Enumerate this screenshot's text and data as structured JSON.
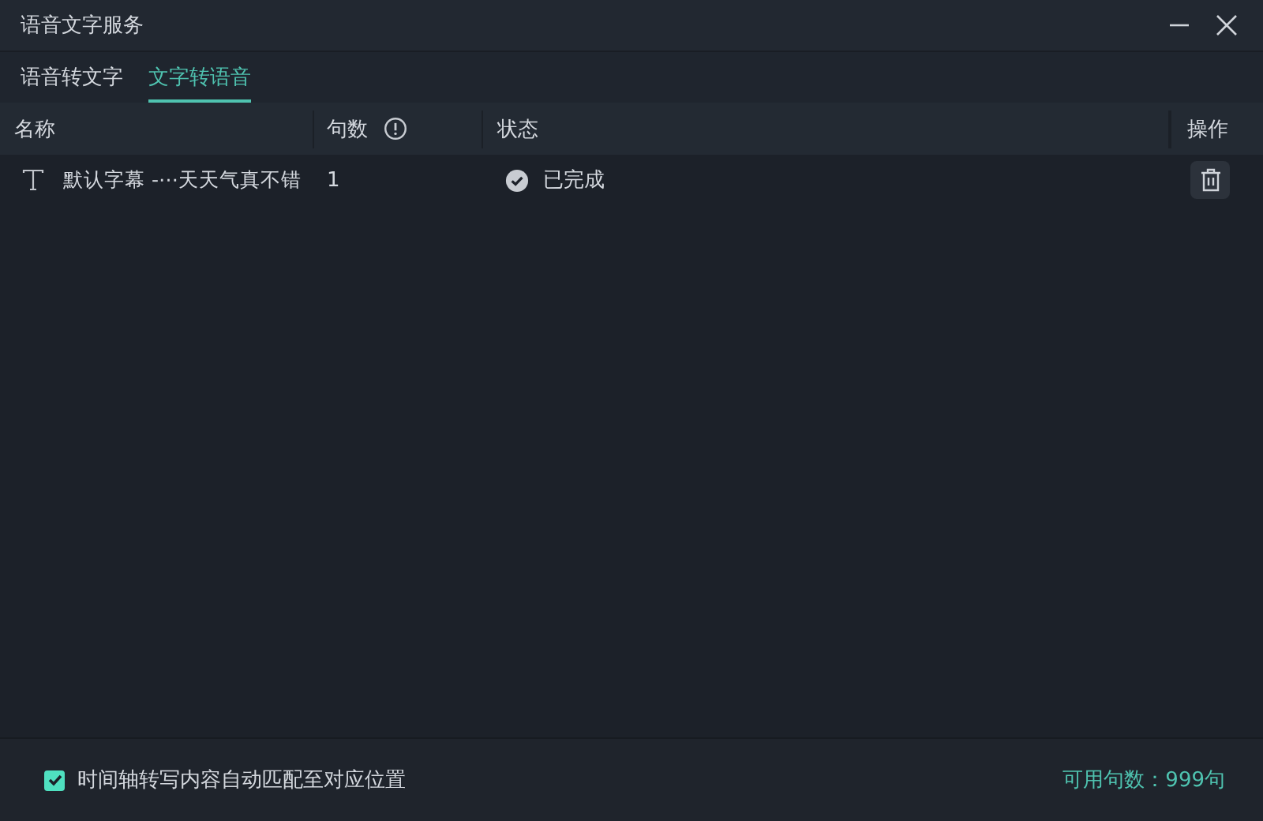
{
  "window": {
    "title": "语音文字服务"
  },
  "tabs": [
    {
      "label": "语音转文字",
      "selected": false
    },
    {
      "label": "文字转语音",
      "selected": true
    }
  ],
  "table": {
    "columns": [
      "名称",
      "句数",
      "状态",
      "操作"
    ],
    "rows": [
      {
        "name": "默认字幕 -⋯天天气真不错",
        "count": "1",
        "status": "已完成",
        "done": true
      }
    ]
  },
  "footer": {
    "option": {
      "label": "时间轴转写内容自动匹配至对应位置",
      "checked": true
    },
    "quota": "可用句数：999句"
  }
}
